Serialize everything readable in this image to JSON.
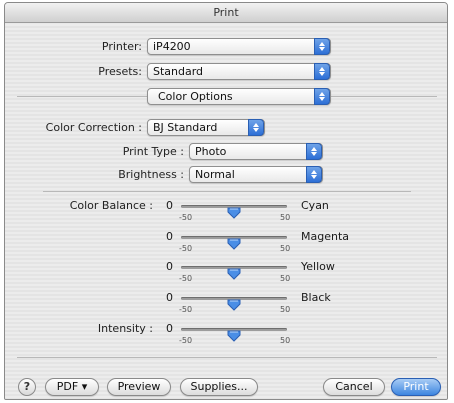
{
  "window": {
    "title": "Print"
  },
  "printer": {
    "label": "Printer:",
    "value": "iP4200"
  },
  "presets": {
    "label": "Presets:",
    "value": "Standard"
  },
  "panel": {
    "value": "Color Options"
  },
  "color_correction": {
    "label": "Color Correction :",
    "value": "BJ Standard"
  },
  "print_type": {
    "label": "Print Type :",
    "value": "Photo"
  },
  "brightness": {
    "label": "Brightness :",
    "value": "Normal"
  },
  "sliders": [
    {
      "label": "Color Balance :",
      "value_text": "0",
      "value": 0,
      "min": -50,
      "max": 50,
      "min_label": "-50",
      "max_label": "50",
      "color": "Cyan"
    },
    {
      "label": "",
      "value_text": "0",
      "value": 0,
      "min": -50,
      "max": 50,
      "min_label": "-50",
      "max_label": "50",
      "color": "Magenta"
    },
    {
      "label": "",
      "value_text": "0",
      "value": 0,
      "min": -50,
      "max": 50,
      "min_label": "-50",
      "max_label": "50",
      "color": "Yellow"
    },
    {
      "label": "",
      "value_text": "0",
      "value": 0,
      "min": -50,
      "max": 50,
      "min_label": "-50",
      "max_label": "50",
      "color": "Black"
    },
    {
      "label": "Intensity :",
      "value_text": "0",
      "value": 0,
      "min": -50,
      "max": 50,
      "min_label": "-50",
      "max_label": "50",
      "color": ""
    }
  ],
  "buttons": {
    "help": "?",
    "pdf": "PDF ▾",
    "preview": "Preview",
    "supplies": "Supplies...",
    "cancel": "Cancel",
    "print": "Print"
  },
  "icons": {
    "help": "help-icon",
    "popup_arrows": "updown-arrows-icon",
    "slider_thumb": "slider-thumb-icon"
  },
  "colors": {
    "accent": "#2d6fd6",
    "default_button": "#3d86e0",
    "thumb": "#4a8ee6"
  }
}
